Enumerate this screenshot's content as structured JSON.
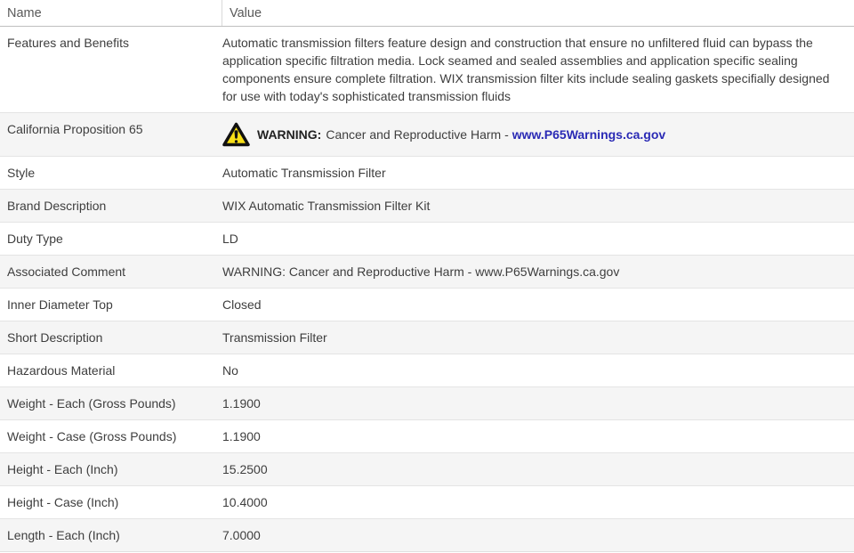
{
  "table": {
    "columns": [
      {
        "label": "Name"
      },
      {
        "label": "Value"
      }
    ],
    "rows": [
      {
        "name": "Features and Benefits",
        "value": "Automatic transmission filters feature design and construction that ensure no unfiltered fluid can bypass the application specific filtration media. Lock seamed and sealed assemblies and application specific sealing components ensure complete filtration. WIX transmission filter kits include sealing gaskets specifially designed for use with today's sophisticated transmission fluids"
      },
      {
        "name": "California Proposition 65",
        "type": "prop65",
        "warning_icon": "warning-triangle-icon",
        "warning_label": "WARNING:",
        "value": "Cancer and Reproductive Harm -",
        "link": "www.P65Warnings.ca.gov"
      },
      {
        "name": "Style",
        "value": "Automatic Transmission Filter"
      },
      {
        "name": "Brand Description",
        "value": "WIX Automatic Transmission Filter Kit"
      },
      {
        "name": "Duty Type",
        "value": "LD"
      },
      {
        "name": "Associated Comment",
        "value": "WARNING: Cancer and Reproductive Harm - www.P65Warnings.ca.gov"
      },
      {
        "name": "Inner Diameter Top",
        "value": "Closed"
      },
      {
        "name": "Short Description",
        "value": "Transmission Filter"
      },
      {
        "name": "Hazardous Material",
        "value": "No"
      },
      {
        "name": "Weight - Each (Gross Pounds)",
        "value": "1.1900"
      },
      {
        "name": "Weight - Case (Gross Pounds)",
        "value": "1.1900"
      },
      {
        "name": "Height - Each (Inch)",
        "value": "15.2500"
      },
      {
        "name": "Height - Case (Inch)",
        "value": "10.4000"
      },
      {
        "name": "Length - Each (Inch)",
        "value": "7.0000"
      }
    ]
  },
  "colors": {
    "stripe": "#f5f5f5",
    "row_border": "#e4e4e4",
    "header_border": "#bfbfbf",
    "text": "#3e3e3e",
    "header_text": "#595959",
    "link": "#2a2ab5",
    "warning_yellow": "#f7df17",
    "warning_outline": "#111111"
  }
}
